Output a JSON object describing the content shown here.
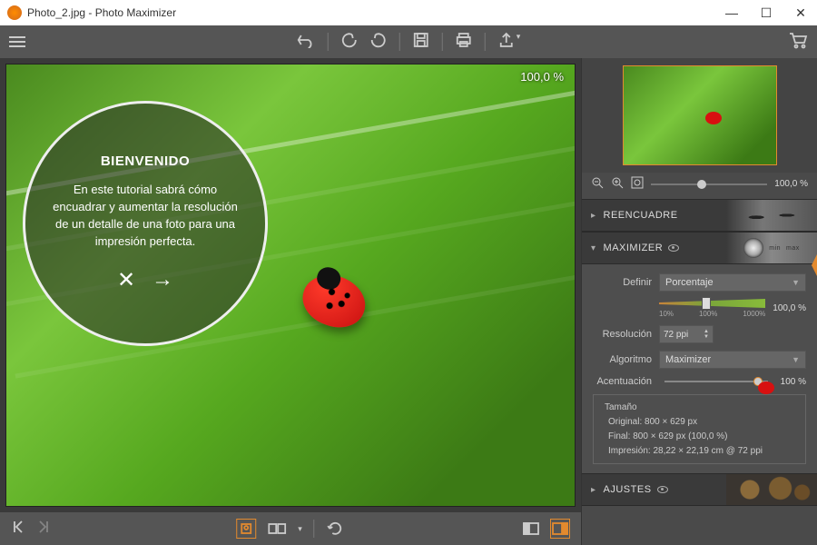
{
  "window": {
    "title": "Photo_2.jpg - Photo Maximizer"
  },
  "canvas": {
    "zoom": "100,0 %"
  },
  "tutorial": {
    "heading": "BIENVENIDO",
    "body": "En este tutorial sabrá cómo encuadrar y aumentar la resolución de un detalle de una foto para una impresión perfecta."
  },
  "thumbStrip": {
    "zoom": "100,0 %"
  },
  "sections": {
    "recut": {
      "title": "REENCUADRE"
    },
    "maximizer": {
      "title": "MAXIMIZER"
    },
    "adjust": {
      "title": "AJUSTES"
    }
  },
  "maximizer": {
    "define_label": "Definir",
    "define_value": "Porcentaje",
    "define_percent": "100,0 %",
    "ticks": {
      "a": "10%",
      "b": "100%",
      "c": "1000%"
    },
    "resolution_label": "Resolución",
    "resolution_value": "72 ppi",
    "algorithm_label": "Algoritmo",
    "algorithm_value": "Maximizer",
    "accent_label": "Acentuación",
    "accent_value": "100 %",
    "size_legend": "Tamaño",
    "size_original": "Original: 800 × 629 px",
    "size_final": "Final: 800 × 629 px (100,0 %)",
    "size_print": "Impresión: 28,22 × 22,19 cm @ 72 ppi"
  },
  "knob": {
    "min": "min",
    "max": "max"
  }
}
